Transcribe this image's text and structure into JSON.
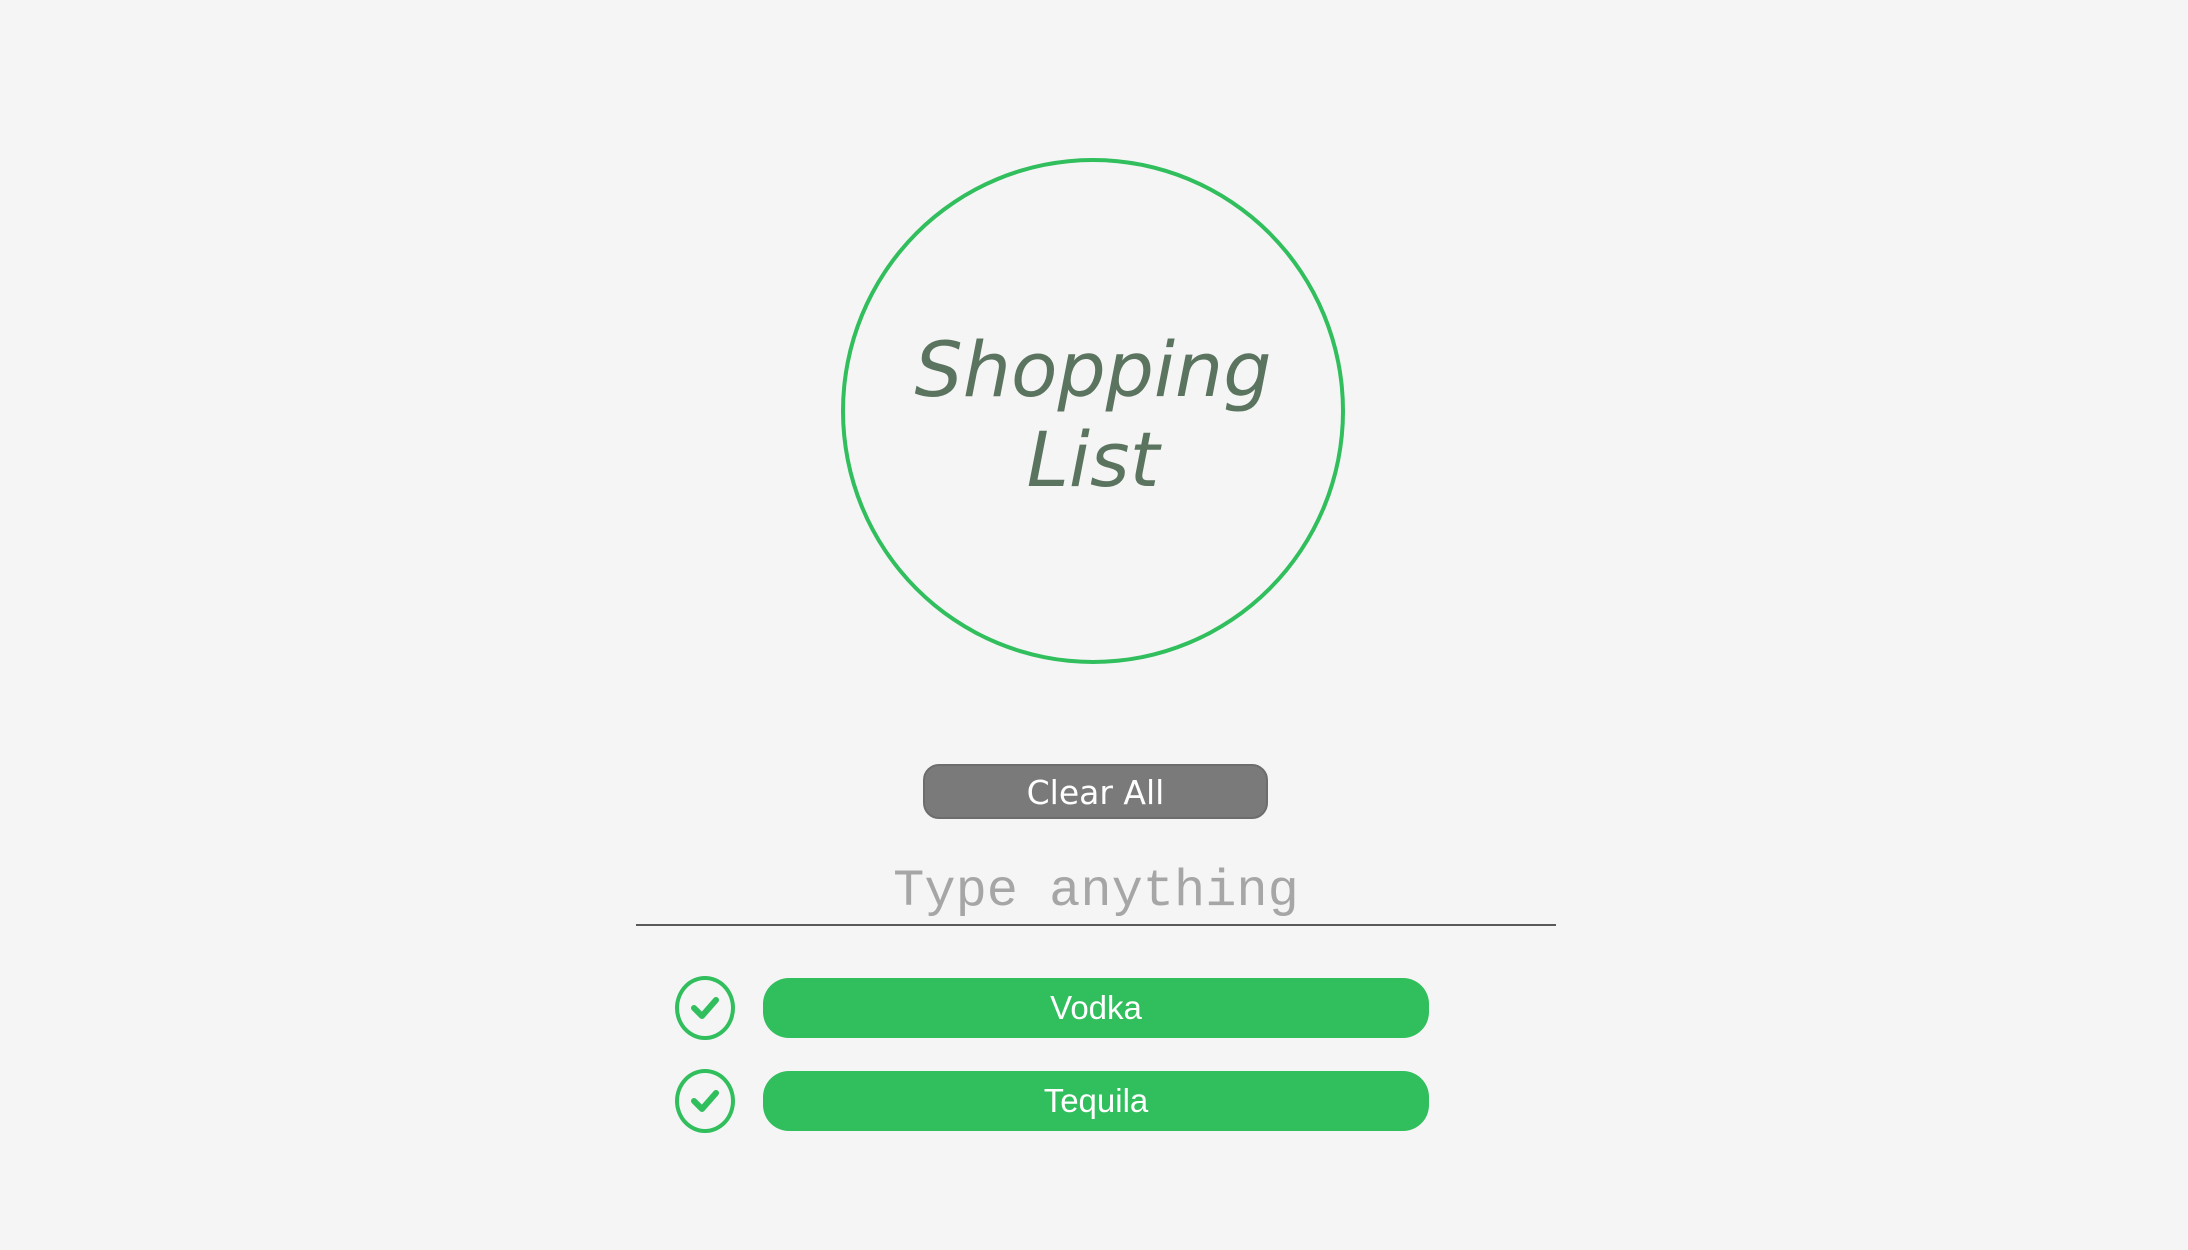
{
  "title": "Shopping List",
  "clear_button": {
    "label": "Clear All"
  },
  "input": {
    "value": "",
    "placeholder": "Type anything"
  },
  "items": [
    {
      "label": "Vodka",
      "checked": true
    },
    {
      "label": "Tequila",
      "checked": true
    }
  ],
  "colors": {
    "accent": "#31be5d",
    "title_text": "#5b745f",
    "button_gray": "#7a7a7a",
    "background": "#f5f5f5"
  }
}
